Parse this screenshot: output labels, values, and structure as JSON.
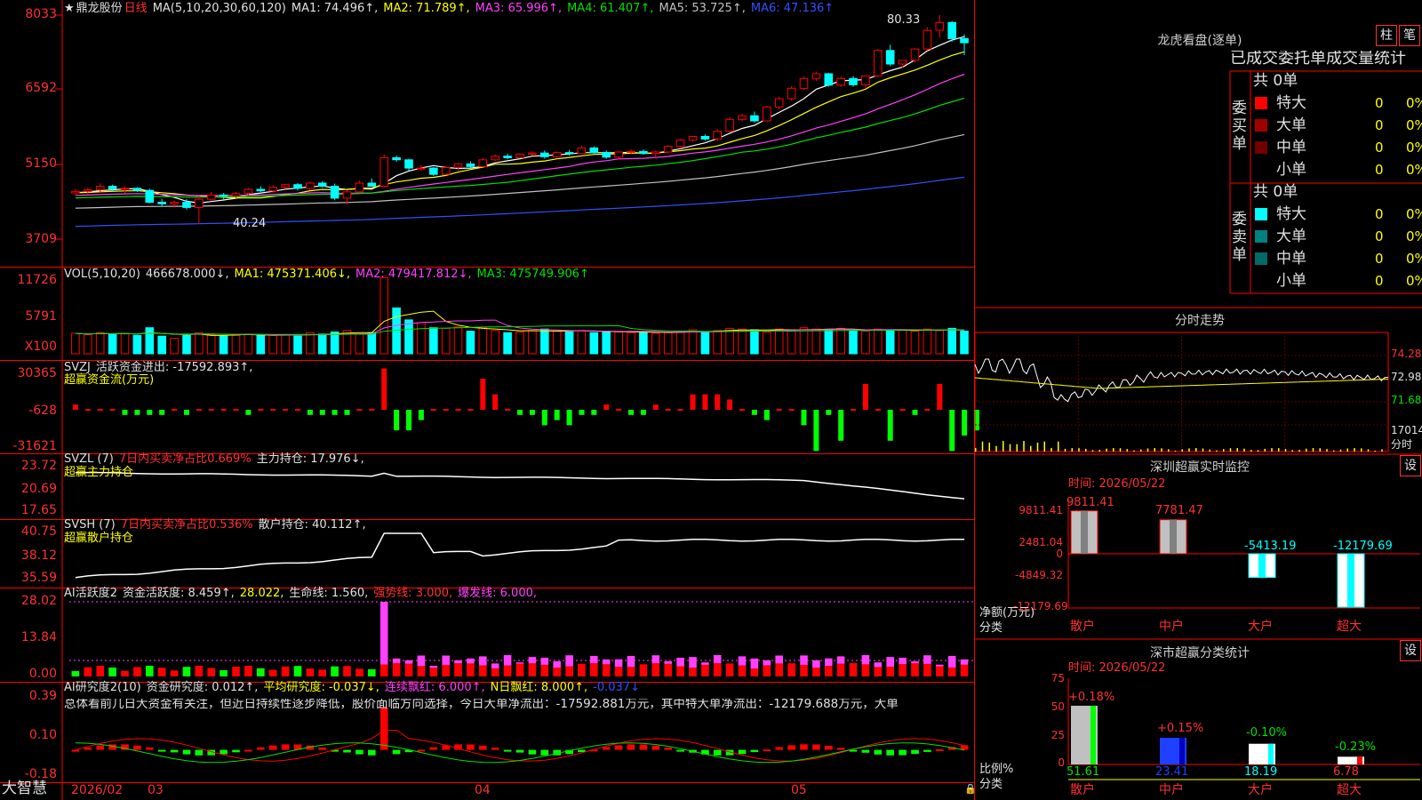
{
  "header": {
    "star": "★",
    "name": "鼎龙股份",
    "period": "日线",
    "ma_label": "MA(5,10,20,30,60,120)",
    "ma1": "MA1: 74.496↑,",
    "ma2": "MA2: 71.789↑,",
    "ma3": "MA3: 65.996↑,",
    "ma4": "MA4: 61.407↑,",
    "ma5": "MA5: 53.725↑,",
    "ma6": "MA6: 47.136↑"
  },
  "price_axis": [
    "8033",
    "6592",
    "5150",
    "3709"
  ],
  "price_annot": {
    "high": "80.33",
    "low": "40.24"
  },
  "vol": {
    "label": "VOL(5,10,20)",
    "v": "466678.000↓,",
    "ma1": "MA1: 475371.406↓,",
    "ma2": "MA2: 479417.812↓,",
    "ma3": "MA3: 475749.906↑",
    "axis": [
      "11726",
      "5791",
      "X100"
    ]
  },
  "svzj": {
    "label": "SVZJ",
    "text": "活跃资金进出: -17592.893↑,",
    "sub": "超赢资金流(万元)",
    "axis": [
      "30365",
      "-628",
      "-31621"
    ]
  },
  "svzl": {
    "label": "SVZL (7)",
    "t1": "7日内买卖净占比0.669%",
    "t2": "主力持仓: 17.976↓,",
    "sub": "超赢主力持仓",
    "axis": [
      "23.72",
      "20.69",
      "17.65"
    ]
  },
  "svsh": {
    "label": "SVSH (7)",
    "t1": "7日内买卖净占比0.536%",
    "t2": "散户持仓: 40.112↑,",
    "sub": "超赢散户持仓",
    "axis": [
      "40.75",
      "38.12",
      "35.59"
    ]
  },
  "ai1": {
    "label": "AI活跃度2",
    "t1": "资金活跃度: 8.459↑,",
    "t2": "28.022,",
    "t3": "生命线: 1.560,",
    "t4": "强势线: 3.000,",
    "t5": "爆发线: 6.000,",
    "axis": [
      "28.02",
      "13.84",
      "0.00"
    ]
  },
  "ai2": {
    "label": "AI研究度2(10)",
    "t1": "资金研究度: 0.012↑,",
    "t2": "平均研究度: -0.037↓,",
    "t3": "连续飘红: 6.000↑,",
    "t4": "N日飘红: 8.000↑,",
    "t5": "-0.037↓",
    "comment": "总体看前几日大资金有关注，但近日持续性逐步降低，股价面临方向选择，今日大单净流出：-17592.881万元，其中特大单净流出：-12179.688万元，大单",
    "axis": [
      "0.39",
      "0.10",
      "-0.18"
    ]
  },
  "bottom": {
    "brand": "大智慧",
    "dates": [
      "2026/02",
      "03",
      "04",
      "05"
    ]
  },
  "right": {
    "lhb_title": "龙虎看盘(逐单)",
    "btn1": "柱",
    "btn2": "笔",
    "tabs": "已成交委托单成交量统计",
    "buy_side": "委买单",
    "sell_side": "委卖单",
    "buy_total": "共 0单",
    "sell_total": "共 0单",
    "buy_rows": [
      {
        "label": "特大",
        "n": "0",
        "p": "0%",
        "color": "#ff0000"
      },
      {
        "label": "大单",
        "n": "0",
        "p": "0%",
        "color": "#a00000"
      },
      {
        "label": "中单",
        "n": "0",
        "p": "0%",
        "color": "#700000"
      },
      {
        "label": "小单",
        "n": "0",
        "p": "0%",
        "color": ""
      }
    ],
    "sell_rows": [
      {
        "label": "特大",
        "n": "0",
        "p": "0%",
        "color": "#00ffff"
      },
      {
        "label": "大单",
        "n": "0",
        "p": "0%",
        "color": "#008080"
      },
      {
        "label": "中单",
        "n": "0",
        "p": "0%",
        "color": "#006a6a"
      },
      {
        "label": "小单",
        "n": "0",
        "p": "0%",
        "color": ""
      }
    ],
    "fenshi_title": "分时走势",
    "fenshi_axis": [
      "74.28",
      "72.98",
      "71.68",
      "17014",
      "分时"
    ],
    "sz_title": "深圳超赢实时监控",
    "sz_btn": "设",
    "sz_time": "时间: 2026/05/22",
    "sz_axis": [
      "9811.41",
      "2481.04",
      "0",
      "-4849.32",
      "-12179.69"
    ],
    "sz_unit": "净额(万元)",
    "sz_fenlei": "分类",
    "sz_cats": [
      "散户",
      "中户",
      "大户",
      "超大"
    ],
    "sz_vals": [
      "9811.41",
      "7781.47",
      "-5413.19",
      "-12179.69"
    ],
    "sc_title": "深市超赢分类统计",
    "sc_btn": "设",
    "sc_time": "时间: 2026/05/22",
    "sc_axis": [
      "75",
      "50",
      "25",
      "0"
    ],
    "sc_unit": "比例%",
    "sc_fenlei": "分类",
    "sc_pcts": [
      "+0.18%",
      "+0.15%",
      "-0.10%",
      "-0.23%"
    ],
    "sc_vals": [
      "51.61",
      "23.41",
      "18.19",
      "6.78"
    ],
    "sc_cats": [
      "散户",
      "中户",
      "大户",
      "超大"
    ]
  },
  "chart_data": {
    "type": "candlestick",
    "candles": [
      [
        46.0,
        46.8,
        45.5,
        46.3
      ],
      [
        46.3,
        47.0,
        45.8,
        46.6
      ],
      [
        46.6,
        47.8,
        46.0,
        47.3
      ],
      [
        47.3,
        47.6,
        46.2,
        46.8
      ],
      [
        46.8,
        47.2,
        46.0,
        46.9
      ],
      [
        46.9,
        47.1,
        46.2,
        46.5
      ],
      [
        46.5,
        46.8,
        44.0,
        44.2
      ],
      [
        44.2,
        44.8,
        43.5,
        43.9
      ],
      [
        43.9,
        44.5,
        43.2,
        44.2
      ],
      [
        44.2,
        44.8,
        42.8,
        43.2
      ],
      [
        43.2,
        45.5,
        40.2,
        44.8
      ],
      [
        44.8,
        46.2,
        44.5,
        45.6
      ],
      [
        45.6,
        46.0,
        44.8,
        45.4
      ],
      [
        45.4,
        46.2,
        45.0,
        45.9
      ],
      [
        45.9,
        47.0,
        45.5,
        46.7
      ],
      [
        46.7,
        47.3,
        46.2,
        46.4
      ],
      [
        46.4,
        47.5,
        46.0,
        47.1
      ],
      [
        47.1,
        47.7,
        46.8,
        47.6
      ],
      [
        47.6,
        47.9,
        46.5,
        46.9
      ],
      [
        46.9,
        48.2,
        46.6,
        47.9
      ],
      [
        47.9,
        48.3,
        47.0,
        47.3
      ],
      [
        47.3,
        47.8,
        44.6,
        45.0
      ],
      [
        45.0,
        46.5,
        43.8,
        46.2
      ],
      [
        46.2,
        48.4,
        46.0,
        47.9
      ],
      [
        47.9,
        48.8,
        47.2,
        47.3
      ],
      [
        47.3,
        53.5,
        47.0,
        52.8
      ],
      [
        52.8,
        53.2,
        52.0,
        52.4
      ],
      [
        52.4,
        52.6,
        50.3,
        50.8
      ],
      [
        50.8,
        51.4,
        50.2,
        50.8
      ],
      [
        50.8,
        51.0,
        49.3,
        49.6
      ],
      [
        49.6,
        51.2,
        49.4,
        50.9
      ],
      [
        50.9,
        51.8,
        50.3,
        51.6
      ],
      [
        51.6,
        52.1,
        50.8,
        51.1
      ],
      [
        51.1,
        52.7,
        51.0,
        52.4
      ],
      [
        52.4,
        53.4,
        52.2,
        53.1
      ],
      [
        53.1,
        53.6,
        52.5,
        52.8
      ],
      [
        52.8,
        53.7,
        52.7,
        53.5
      ],
      [
        53.5,
        54.1,
        53.2,
        53.7
      ],
      [
        53.7,
        54.2,
        52.6,
        53.0
      ],
      [
        53.0,
        54.0,
        52.8,
        53.8
      ],
      [
        53.8,
        54.3,
        53.2,
        53.6
      ],
      [
        53.6,
        55.1,
        53.5,
        54.7
      ],
      [
        54.7,
        55.0,
        53.6,
        53.8
      ],
      [
        53.8,
        54.2,
        52.6,
        52.9
      ],
      [
        52.9,
        54.1,
        52.6,
        53.9
      ],
      [
        53.9,
        54.5,
        53.5,
        54.0
      ],
      [
        54.0,
        54.4,
        53.4,
        53.6
      ],
      [
        53.6,
        54.2,
        53.0,
        53.9
      ],
      [
        53.9,
        55.2,
        53.7,
        55.0
      ],
      [
        55.0,
        56.4,
        54.8,
        56.2
      ],
      [
        56.2,
        57.0,
        55.9,
        56.9
      ],
      [
        56.9,
        57.3,
        56.1,
        56.4
      ],
      [
        56.4,
        58.3,
        56.0,
        57.9
      ],
      [
        57.9,
        60.6,
        57.6,
        60.2
      ],
      [
        60.2,
        61.3,
        59.8,
        60.9
      ],
      [
        60.9,
        61.7,
        59.6,
        59.9
      ],
      [
        59.9,
        62.8,
        59.8,
        62.6
      ],
      [
        62.6,
        64.6,
        62.2,
        64.2
      ],
      [
        64.2,
        66.6,
        63.8,
        66.2
      ],
      [
        66.2,
        68.5,
        65.8,
        68.1
      ],
      [
        68.1,
        69.4,
        67.6,
        69.0
      ],
      [
        69.0,
        69.2,
        66.5,
        66.8
      ],
      [
        66.8,
        68.5,
        66.4,
        68.1
      ],
      [
        68.1,
        68.6,
        66.5,
        66.9
      ],
      [
        66.9,
        67.2,
        66.3,
        68.6
      ],
      [
        68.6,
        73.8,
        68.4,
        73.5
      ],
      [
        73.5,
        74.6,
        70.5,
        70.9
      ],
      [
        70.9,
        71.4,
        70.2,
        71.6
      ],
      [
        71.6,
        74.0,
        71.2,
        73.8
      ],
      [
        73.8,
        78.0,
        73.5,
        77.4
      ],
      [
        77.4,
        80.33,
        76.0,
        78.9
      ],
      [
        78.9,
        79.2,
        75.2,
        75.8
      ],
      [
        75.8,
        76.6,
        72.6,
        75.0
      ]
    ],
    "ma_series": [
      {
        "name": "MA1",
        "value": "74.496",
        "color": "#ffffff"
      },
      {
        "name": "MA2",
        "value": "71.789",
        "color": "#ffff00"
      },
      {
        "name": "MA3",
        "value": "65.996",
        "color": "#ff40ff"
      },
      {
        "name": "MA4",
        "value": "61.407",
        "color": "#00e000"
      },
      {
        "name": "MA5",
        "value": "53.725",
        "color": "#c0c0c0"
      },
      {
        "name": "MA6",
        "value": "47.136",
        "color": "#3050ff"
      }
    ],
    "y_range": [
      37.09,
      80.33
    ],
    "vol_scale": [
      0,
      11726
    ],
    "vol": [
      2900,
      2700,
      3000,
      2800,
      2900,
      2600,
      3700,
      2500,
      2200,
      2600,
      3000,
      2700,
      2500,
      2600,
      2800,
      2700,
      2600,
      2700,
      2500,
      3000,
      2800,
      3100,
      3300,
      2800,
      3000,
      10800,
      6500,
      4800,
      4400,
      3700,
      3600,
      3800,
      3200,
      3700,
      3300,
      3000,
      3100,
      3300,
      3500,
      3200,
      3100,
      3300,
      3000,
      3200,
      3100,
      3000,
      3100,
      2900,
      3000,
      3200,
      3400,
      3100,
      3300,
      3600,
      3500,
      3400,
      3100,
      3500,
      3400,
      3700,
      3500,
      3400,
      3600,
      3300,
      3200,
      3500,
      3300,
      3400,
      3200,
      3500,
      3300,
      3600,
      3200
    ],
    "svzj": [
      1,
      0,
      0,
      0,
      -1,
      -1,
      -1,
      -1,
      0,
      -1,
      0,
      0,
      0,
      0,
      -1,
      0,
      0,
      0,
      0,
      -1,
      -1,
      -1,
      -1,
      0,
      0,
      8,
      -4,
      -4,
      -2,
      0,
      0,
      0,
      0,
      6,
      3,
      0,
      -1,
      -1,
      -3,
      -2,
      -3,
      -1,
      -1,
      1,
      0,
      -1,
      -1,
      1,
      0,
      0,
      3,
      3,
      3,
      2,
      0,
      -1,
      -2,
      0,
      0,
      -3,
      -8,
      -1,
      -6,
      0,
      5,
      0,
      -6,
      0,
      -1,
      0,
      5,
      -8,
      -5,
      -4
    ],
    "svzl_range": [
      17.65,
      23.72
    ],
    "svsh_range": [
      35.59,
      40.75
    ],
    "ai1_max": 28.02,
    "ai2_range": [
      -0.18,
      0.39
    ]
  }
}
